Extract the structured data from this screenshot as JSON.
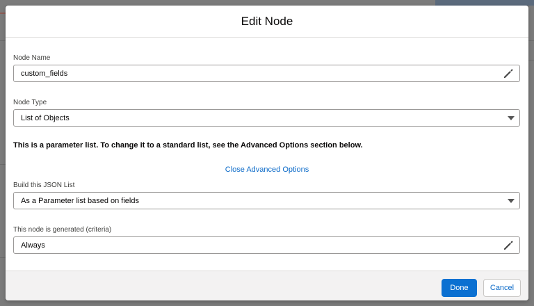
{
  "modal": {
    "title": "Edit Node",
    "node_name": {
      "label": "Node Name",
      "value": "custom_fields",
      "icon": "pencil-icon"
    },
    "node_type": {
      "label": "Node Type",
      "value": "List of Objects",
      "icon": "caret-down-icon"
    },
    "notice": "This is a parameter list. To change it to a standard list, see the Advanced Options section below.",
    "advanced_link": "Close Advanced Options",
    "json_list": {
      "label": "Build this JSON List",
      "value": "As a Parameter list based on fields",
      "icon": "caret-down-icon"
    },
    "criteria": {
      "label": "This node is generated (criteria)",
      "value": "Always",
      "icon": "pencil-icon"
    },
    "footer": {
      "done_label": "Done",
      "cancel_label": "Cancel"
    }
  },
  "colors": {
    "brand": "#0b70d1",
    "link": "#0b6ac8",
    "overlay": "#7e7e7e"
  }
}
